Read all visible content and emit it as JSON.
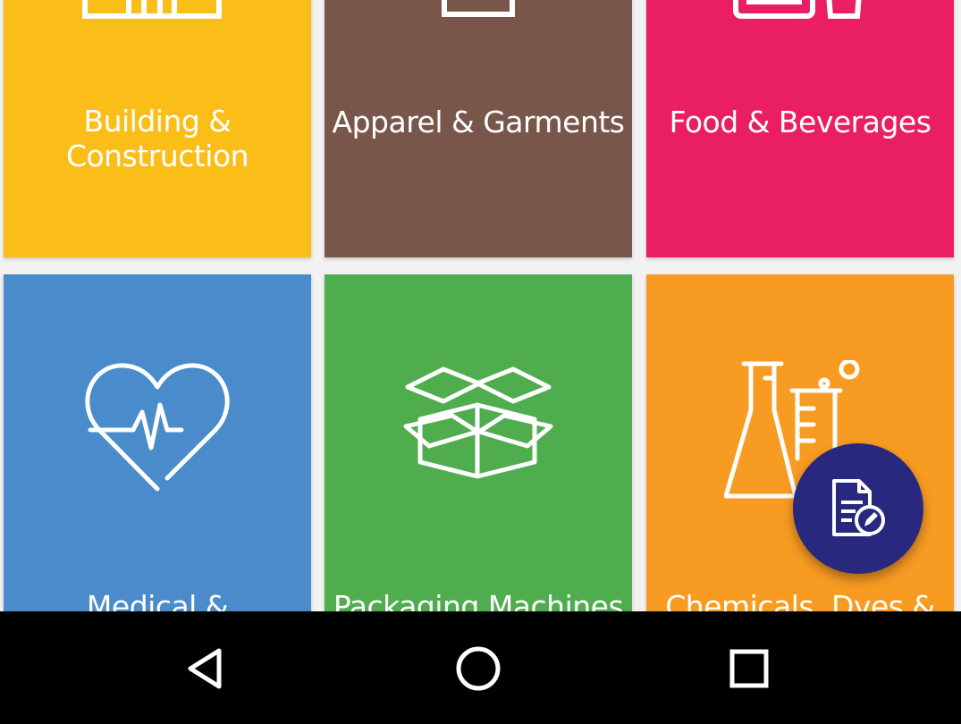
{
  "categories": [
    {
      "label": "Building &\nConstruction",
      "color": "#FBBD18",
      "icon": "buildings-icon"
    },
    {
      "label": "Apparel & Garments",
      "color": "#79564A",
      "icon": "apparel-icon"
    },
    {
      "label": "Food & Beverages",
      "color": "#E91E63",
      "icon": "food-icon"
    },
    {
      "label": "Medical &",
      "color": "#4A8BCB",
      "icon": "heart-pulse-icon"
    },
    {
      "label": "Packaging Machines",
      "color": "#4FAD4E",
      "icon": "open-box-icon"
    },
    {
      "label": "Chemicals, Dyes &",
      "color": "#F89B22",
      "icon": "lab-flask-icon"
    }
  ],
  "fab": {
    "icon": "edit-document-icon",
    "color": "#28287F"
  },
  "nav": {
    "back_icon": "back-triangle-icon",
    "home_icon": "home-circle-icon",
    "recents_icon": "recents-square-icon"
  }
}
